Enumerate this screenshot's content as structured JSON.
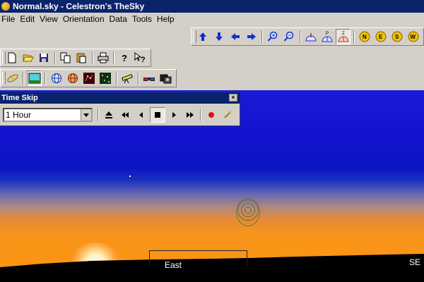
{
  "window": {
    "title": "Normal.sky - Celestron's TheSky"
  },
  "menu": [
    "File",
    "Edit",
    "View",
    "Orientation",
    "Data",
    "Tools",
    "Help"
  ],
  "time_skip": {
    "title": "Time Skip",
    "interval_value": "1 Hour",
    "close_label": "×"
  },
  "sky": {
    "east_label": "East",
    "se_label": "SE"
  },
  "colors": {
    "titlebar": "#0a246a",
    "chrome": "#d4d0c8",
    "sky_top": "#1414cf",
    "sky_horizon": "#ff9410"
  }
}
